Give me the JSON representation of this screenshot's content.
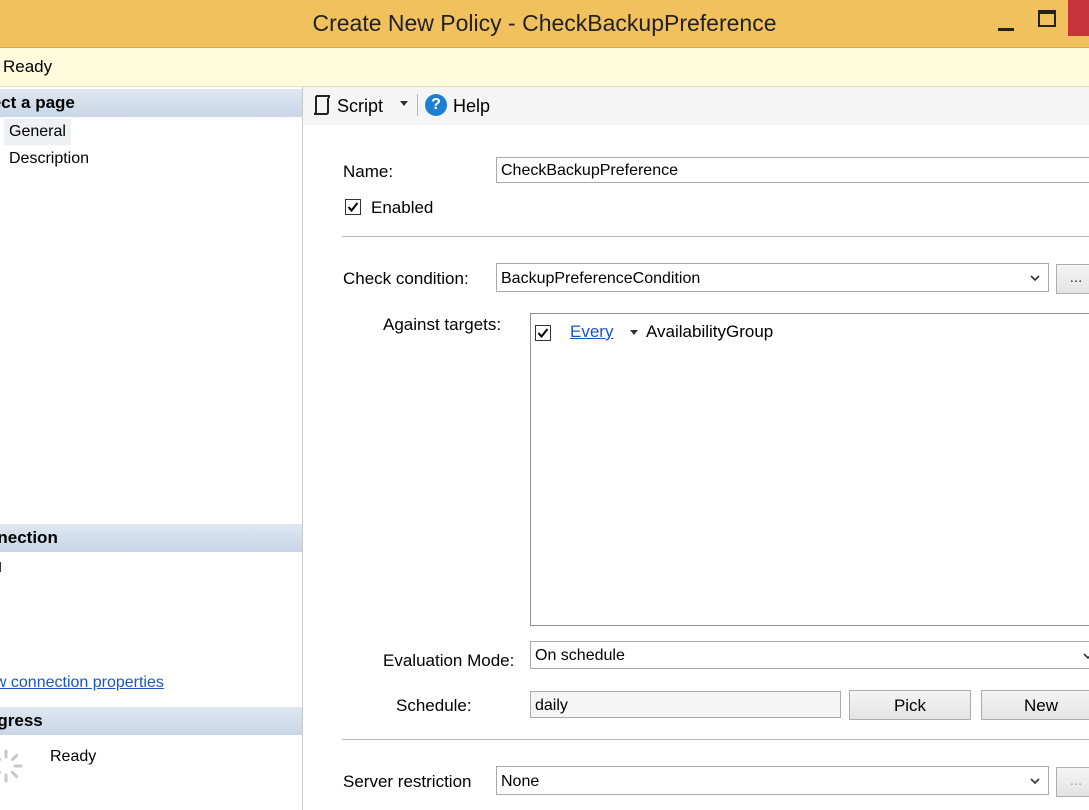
{
  "window": {
    "title": "Create New Policy - CheckBackupPreference",
    "status": "Ready"
  },
  "left_panel": {
    "select_page_header": "lect a page",
    "pages": [
      {
        "label": "General",
        "selected": true
      },
      {
        "label": "Description",
        "selected": false
      }
    ],
    "connection_header": "nnection",
    "connection_link": "ew connection properties",
    "progress_header": "ogress",
    "progress_status": "Ready"
  },
  "toolbar": {
    "script_label": "Script",
    "help_label": "Help"
  },
  "form": {
    "name_label": "Name:",
    "name_value": "CheckBackupPreference",
    "enabled_label": "Enabled",
    "enabled_checked": true,
    "check_condition_label": "Check condition:",
    "check_condition_value": "BackupPreferenceCondition",
    "ellipsis_label": "...",
    "against_targets_label": "Against targets:",
    "targets": [
      {
        "checked": true,
        "quantifier": "Every",
        "target": "AvailabilityGroup"
      }
    ],
    "evaluation_mode_label": "Evaluation Mode:",
    "evaluation_mode_value": "On schedule",
    "schedule_label": "Schedule:",
    "schedule_value": "daily",
    "pick_label": "Pick",
    "new_label": "New",
    "server_restriction_label": "Server restriction",
    "server_restriction_value": "None",
    "server_ellipsis_label": "..."
  },
  "colors": {
    "titlebar": "#f1c15d",
    "statusbar": "#fffbdc",
    "section_header": "#c9d6e7",
    "link": "#1a55c8",
    "close": "#c7333a",
    "help_icon": "#1c7fd4"
  }
}
